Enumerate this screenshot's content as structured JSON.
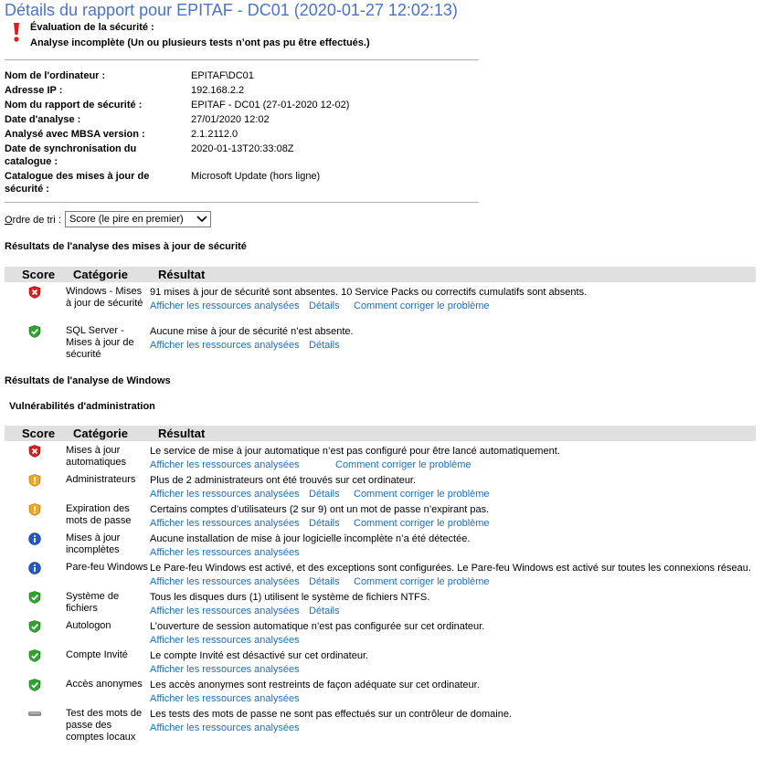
{
  "title": "Détails du rapport pour EPITAF - DC01 (2020-01-27 12:02:13)",
  "assessment": {
    "label": "Évaluation de la sécurité :",
    "value": "Analyse incomplète (Un ou plusieurs tests n’ont pas pu être effectués.)"
  },
  "info": [
    {
      "label": "Nom de l'ordinateur :",
      "value": "EPITAF\\DC01"
    },
    {
      "label": "Adresse IP :",
      "value": "192.168.2.2"
    },
    {
      "label": "Nom du rapport de sécurité :",
      "value": "EPITAF - DC01 (27-01-2020 12-02)"
    },
    {
      "label": "Date d'analyse :",
      "value": "27/01/2020 12:02"
    },
    {
      "label": "Analysé avec MBSA version :",
      "value": "2.1.2112.0"
    },
    {
      "label": "Date de synchronisation du catalogue :",
      "value": "2020-01-13T20:33:08Z"
    },
    {
      "label": "Catalogue des mises à jour de sécurité :",
      "value": "Microsoft Update (hors ligne)"
    }
  ],
  "sort": {
    "label_u": "O",
    "label_rest": "rdre de tri :",
    "selected": "Score (le pire en premier)"
  },
  "headers": {
    "score": "Score",
    "category": "Catégorie",
    "result": "Résultat"
  },
  "links": {
    "resources": "Afficher les ressources analysées",
    "details": "Détails",
    "fix": "Comment corriger le problème"
  },
  "updates_section": "Résultats de l'analyse des mises à jour de sécurité",
  "updates": [
    {
      "icon": "fail-shield-icon",
      "category": "Windows - Mises à jour de sécurité",
      "result": "91 mises à jour de sécurité sont absentes. 10 Service Packs ou correctifs cumulatifs sont absents."
    },
    {
      "icon": "pass-shield-icon",
      "category": "SQL Server - Mises à jour de sécurité",
      "result": "Aucune mise à jour de sécurité n’est absente."
    }
  ],
  "windows_section": "Résultats de l'analyse de Windows",
  "admin_subsection": "Vulnérabilités d'administration",
  "checks": [
    {
      "icon": "fail-shield-icon",
      "category": "Mises à jour automatiques",
      "result": "Le service de mise à jour automatique n’est pas configuré pour être lancé automatiquement."
    },
    {
      "icon": "warning-shield-icon",
      "category": "Administrateurs",
      "result": "Plus de 2 administrateurs ont été trouvés sur cet ordinateur."
    },
    {
      "icon": "warning-shield-icon",
      "category": "Expiration des mots de passe",
      "result": "Certains comptes d’utilisateurs (2 sur 9) ont un mot de passe n’expirant pas."
    },
    {
      "icon": "info-icon",
      "category": "Mises à jour incomplètes",
      "result": "Aucune installation de mise à jour logicielle incomplète n’a été détectée."
    },
    {
      "icon": "info-icon",
      "category": "Pare-feu Windows",
      "result": "Le Pare-feu Windows est activé, et des exceptions sont configurées. Le Pare-feu Windows est activé sur toutes les connexions réseau."
    },
    {
      "icon": "pass-shield-icon",
      "category": "Système de fichiers",
      "result": "Tous les disques durs (1) utilisent le système de fichiers NTFS."
    },
    {
      "icon": "pass-shield-icon",
      "category": "Autologon",
      "result": "L’ouverture de session automatique n’est pas configurée sur cet ordinateur."
    },
    {
      "icon": "pass-shield-icon",
      "category": "Compte Invité",
      "result": "Le compte Invité est désactivé sur cet ordinateur."
    },
    {
      "icon": "pass-shield-icon",
      "category": "Accès anonymes",
      "result": "Les accès anonymes sont restreints de façon adéquate sur cet ordinateur."
    },
    {
      "icon": "not-performed-icon",
      "category": "Test des mots de passe des comptes locaux",
      "result": "Les tests des mots de passe ne sont pas effectués sur un contrôleur de domaine."
    }
  ]
}
